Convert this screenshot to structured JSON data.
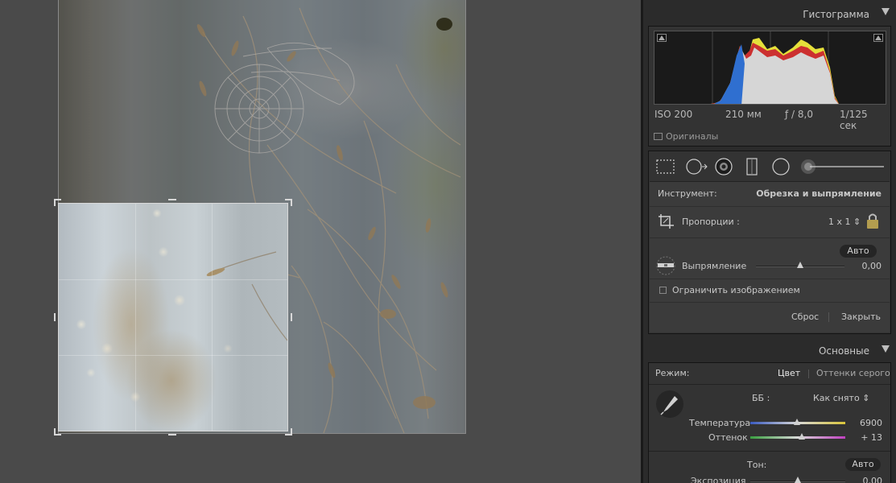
{
  "histogram": {
    "title": "Гистограмма",
    "iso": "ISO 200",
    "focal": "210 мм",
    "aperture": "ƒ / 8,0",
    "shutter": "1/125 сек",
    "originals_label": "Оригиналы"
  },
  "crop_tool": {
    "tool_label": "Инструмент:",
    "tool_name": "Обрезка и выпрямление",
    "aspect_label": "Пропорции :",
    "aspect_value": "1 x 1",
    "auto_label": "Авто",
    "straighten_label": "Выпрямление",
    "straighten_value": "0,00",
    "constrain_label": "Ограничить изображением",
    "reset_label": "Сброс",
    "close_label": "Закрыть"
  },
  "basic": {
    "title": "Основные",
    "mode_label": "Режим:",
    "mode_color": "Цвет",
    "mode_gray": "Оттенки серого",
    "wb_label": "ББ :",
    "wb_value": "Как снято",
    "temp_label": "Температура",
    "temp_value": "6900",
    "tint_label": "Оттенок",
    "tint_value": "+ 13",
    "tone_label": "Тон:",
    "tone_auto": "Авто",
    "exposure_label": "Экспозиция",
    "exposure_value": "0,00"
  },
  "colors": {
    "panel_bg": "#2b2b2b",
    "canvas_bg": "#4a4a4a",
    "histogram_blue": "#2f6fd0",
    "histogram_yellow": "#e8e23a",
    "histogram_red": "#d03030"
  }
}
